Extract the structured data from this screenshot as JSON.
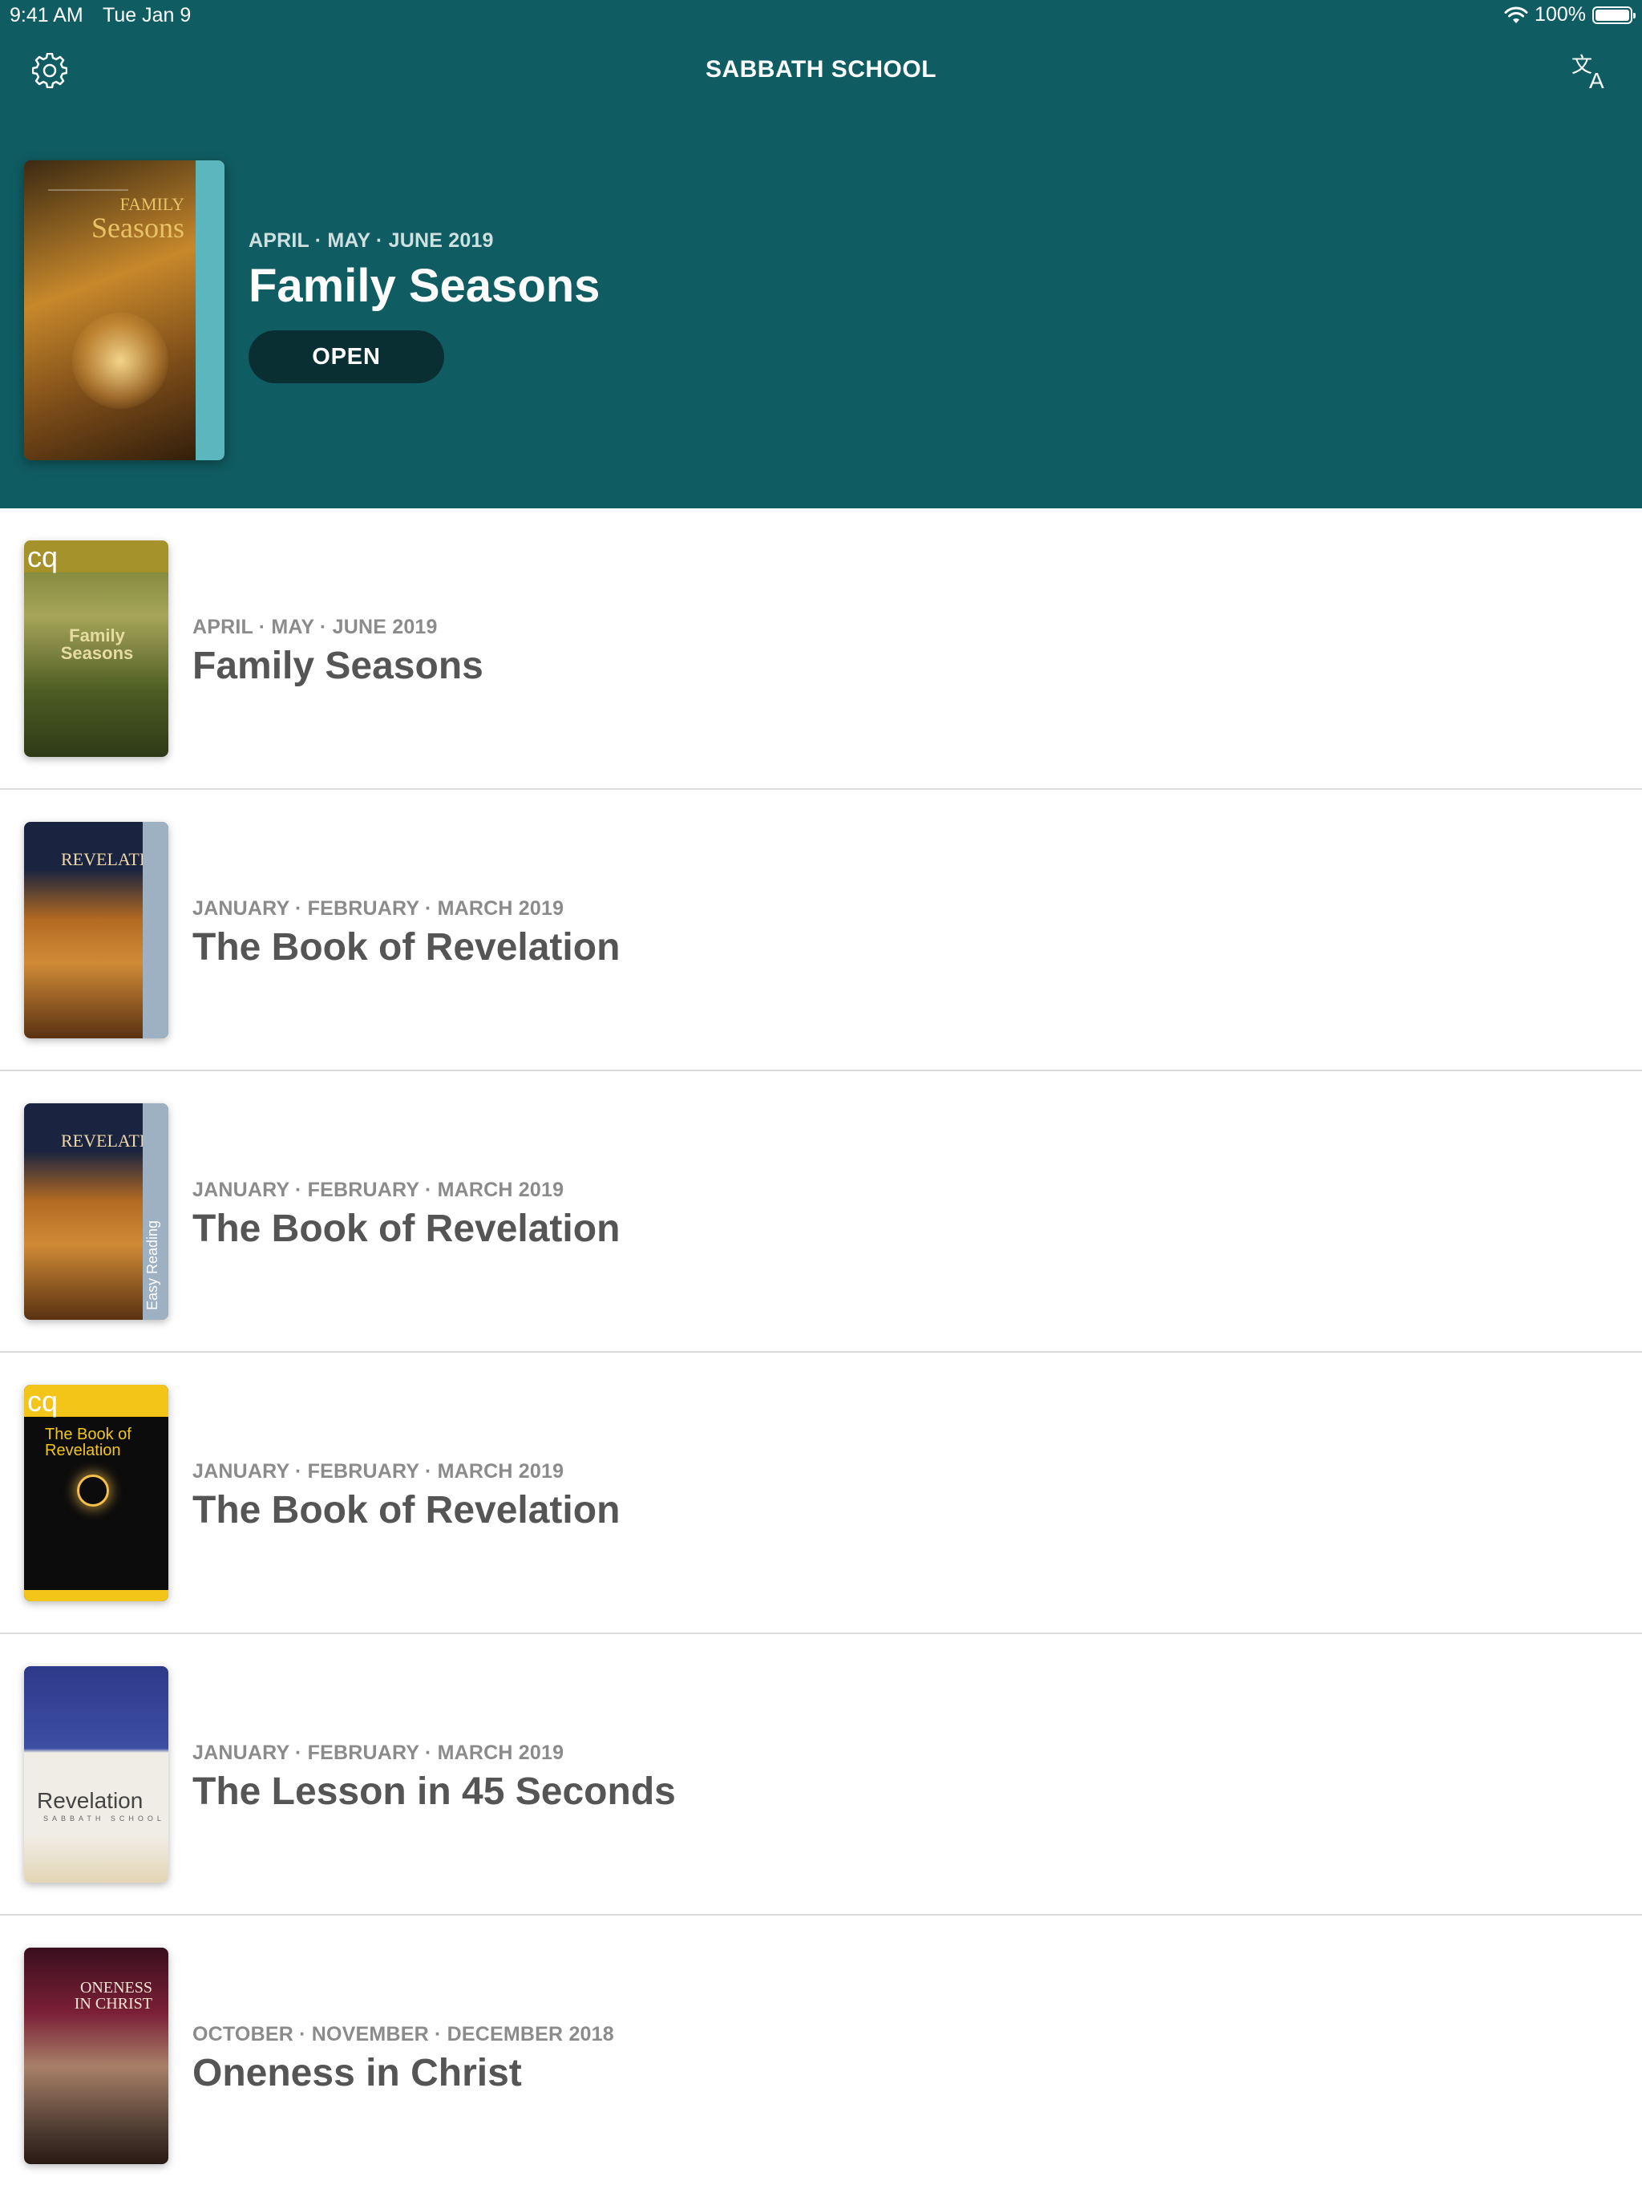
{
  "status_bar": {
    "time": "9:41 AM",
    "date": "Tue Jan 9",
    "battery": "100%"
  },
  "nav": {
    "title": "SABBATH SCHOOL",
    "left_icon": "gear-icon",
    "right_icon": "translate-icon"
  },
  "featured": {
    "date": "APRIL · MAY · JUNE 2019",
    "title": "Family Seasons",
    "open_label": "OPEN",
    "cover_text_1": "FAMILY",
    "cover_text_2": "Seasons"
  },
  "quarterlies": [
    {
      "date": "APRIL · MAY · JUNE 2019",
      "title": "Family Seasons",
      "cover_style": "cq1",
      "cover_text": "Family Seasons",
      "cover_mark": "cq"
    },
    {
      "date": "JANUARY · FEBRUARY · MARCH 2019",
      "title": "The Book of Revelation",
      "cover_style": "rev1",
      "cover_text": "REVELATION"
    },
    {
      "date": "JANUARY · FEBRUARY · MARCH 2019",
      "title": "The Book of Revelation",
      "cover_style": "rev2",
      "cover_text": "REVELATION",
      "spine_text": "Easy Reading"
    },
    {
      "date": "JANUARY · FEBRUARY · MARCH 2019",
      "title": "The Book of Revelation",
      "cover_style": "cq2",
      "cover_text": "The Book of Revelation",
      "cover_mark": "cq"
    },
    {
      "date": "JANUARY · FEBRUARY · MARCH 2019",
      "title": "The Lesson in 45 Seconds",
      "cover_style": "lesson",
      "cover_text": "Revelation",
      "cover_subtext": "SABBATH SCHOOL"
    },
    {
      "date": "OCTOBER · NOVEMBER · DECEMBER 2018",
      "title": "Oneness in Christ",
      "cover_style": "oneness",
      "cover_text": "ONENESS IN CHRIST"
    }
  ],
  "colors": {
    "header_bg": "#0f5c62",
    "open_button_bg": "#0a2f33",
    "list_title": "#555555",
    "list_date": "#8b8b8b"
  }
}
